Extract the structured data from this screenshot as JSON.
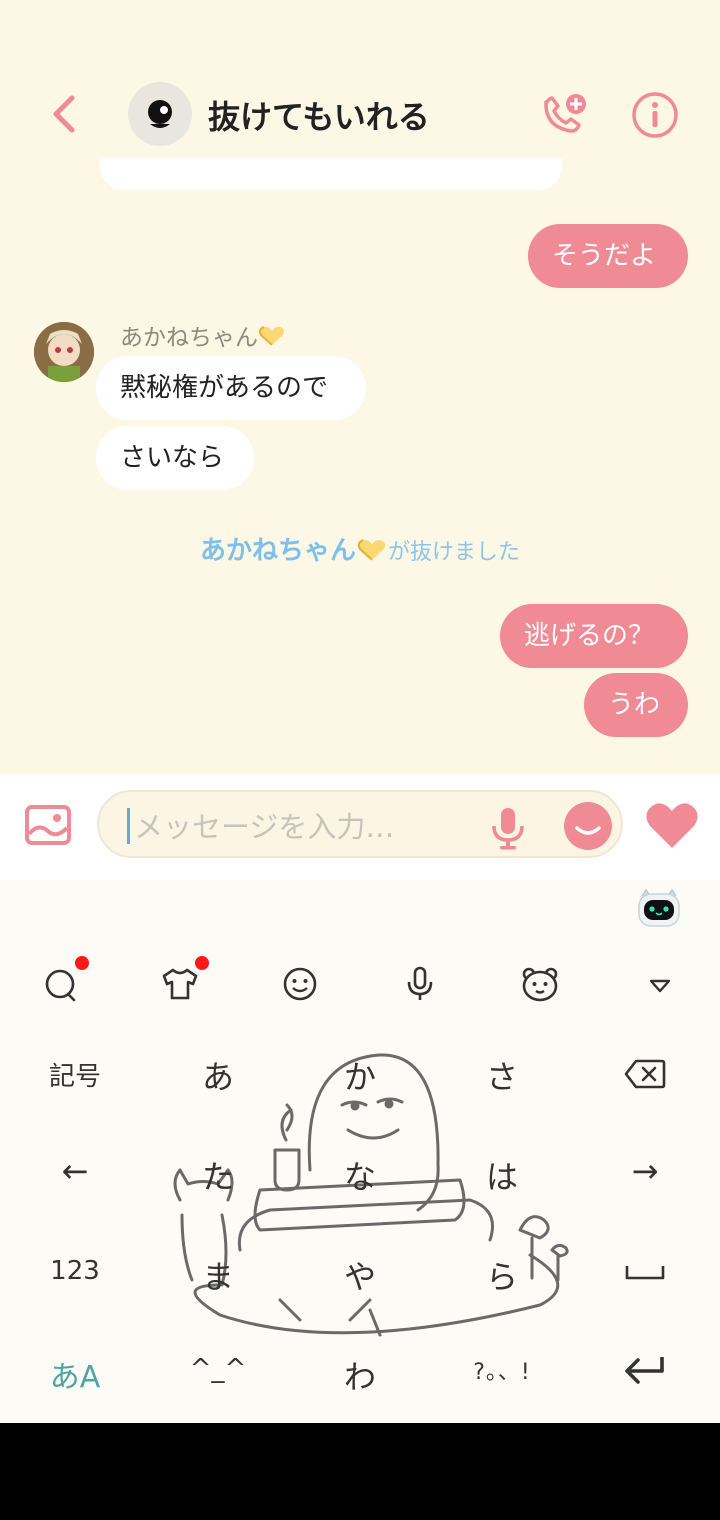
{
  "header": {
    "title": "抜けてもいれる",
    "back_icon": "chevron-left-icon",
    "call_icon": "phone-add-icon",
    "info_icon": "info-icon"
  },
  "messages": [
    {
      "side": "me",
      "text": "そうだよ"
    },
    {
      "side": "other",
      "sender": "あかねちゃん",
      "text": "黙秘権があるので"
    },
    {
      "side": "other",
      "text": "さいなら"
    },
    {
      "side": "system",
      "name": "あかねちゃん",
      "text": "が抜けました"
    },
    {
      "side": "me",
      "text": "逃げるの？"
    },
    {
      "side": "me",
      "text": "うわ"
    }
  ],
  "input": {
    "placeholder": "メッセージを入力…",
    "image_icon": "image-icon",
    "mic_icon": "microphone-icon",
    "emoji_icon": "emoji-icon",
    "like_icon": "heart-icon"
  },
  "keyboard": {
    "toolbar": [
      "search-icon",
      "shirt-icon",
      "smiley-icon",
      "microphone-icon",
      "bear-face-icon",
      "collapse-icon"
    ],
    "rows": [
      [
        "記号",
        "あ",
        "か",
        "さ",
        "⌫"
      ],
      [
        "←",
        "た",
        "な",
        "は",
        "→"
      ],
      [
        "123",
        "ま",
        "や",
        "ら",
        "␣"
      ],
      [
        "あA",
        "^_^",
        "わ",
        "?。、!",
        "↵"
      ]
    ]
  },
  "colors": {
    "accent": "#f08b95",
    "chat_bg": "#fdf7e6",
    "system_text": "#8fc5e8"
  }
}
